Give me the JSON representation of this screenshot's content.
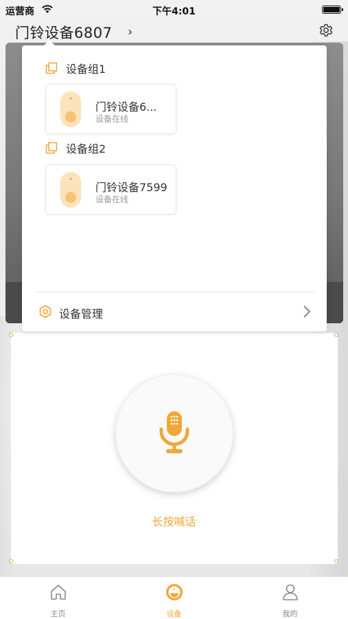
{
  "status_bar": {
    "carrier": "运营商",
    "time": "下午4:01"
  },
  "header": {
    "device_title": "门铃设备6807",
    "chevron": "›",
    "settings_icon": "gear-icon"
  },
  "popover": {
    "groups": [
      {
        "label": "设备组1",
        "icon": "group-icon",
        "devices": [
          {
            "name": "门铃设备6...",
            "status": "设备在线"
          }
        ]
      },
      {
        "label": "设备组2",
        "icon": "group-icon",
        "devices": [
          {
            "name": "门铃设备7599",
            "status": "设备在线"
          }
        ]
      }
    ],
    "manage": {
      "label": "设备管理",
      "icon": "gear-icon"
    }
  },
  "talk": {
    "label": "长按喊话",
    "icon": "microphone-icon"
  },
  "tab_bar": {
    "tabs": [
      {
        "label": "主页",
        "icon": "home-icon",
        "active": false
      },
      {
        "label": "设备",
        "icon": "device-icon",
        "active": true
      },
      {
        "label": "我的",
        "icon": "profile-icon",
        "active": false
      }
    ]
  },
  "colors": {
    "accent": "#f0a83a",
    "accent_light": "#fcd9a0",
    "text": "#333333",
    "muted": "#999999"
  }
}
